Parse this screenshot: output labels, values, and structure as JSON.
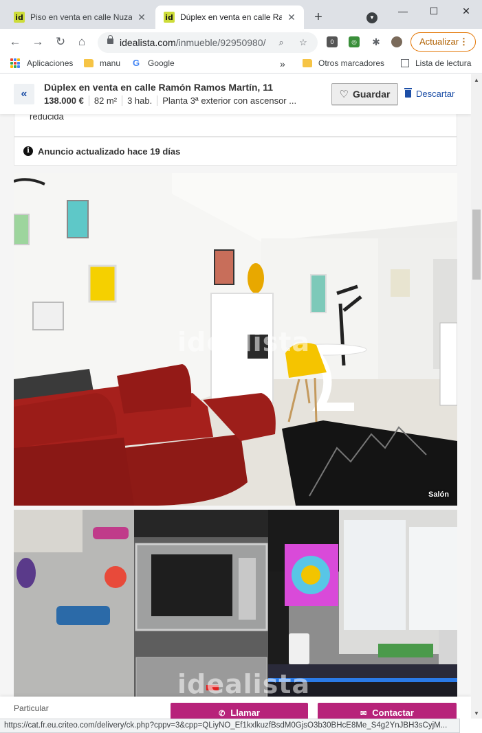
{
  "browser": {
    "tabs": [
      {
        "title": "Piso en venta en calle Nuzas",
        "favicon": "id",
        "active": false
      },
      {
        "title": "Dúplex en venta en calle Ram",
        "favicon": "id",
        "active": true
      }
    ],
    "new_tab_icon": "+",
    "url_domain": "idealista.com",
    "url_path": "/inmueble/92950980/",
    "update_button": "Actualizar",
    "bookmarks": {
      "apps": "Aplicaciones",
      "manu": "manu",
      "google": "Google",
      "more": "»",
      "other": "Otros marcadores",
      "reading_list": "Lista de lectura"
    }
  },
  "listing": {
    "title": "Dúplex en venta en calle Ramón Ramos Martín, 11",
    "price": "138.000 €",
    "size": "82 m²",
    "rooms": "3 hab.",
    "floor": "Planta 3ª exterior con ascensor ...",
    "save_label": "Guardar",
    "discard_label": "Descartar",
    "reduced_fragment": "reducida",
    "updated_notice": "Anuncio actualizado hace 19 días"
  },
  "photos": [
    {
      "caption": "Salón",
      "watermark": "idealista"
    },
    {
      "caption": "",
      "watermark": "idealista"
    }
  ],
  "contact": {
    "advertiser_type": "Particular",
    "call_label": "Llamar",
    "contact_label": "Contactar"
  },
  "status_bar": "https://cat.fr.eu.criteo.com/delivery/ck.php?cppv=3&cpp=QLiyNO_Ef1kxlkuzfBsdM0GjsO3b30BHcE8Me_S4g2YnJBH3sCyjM...",
  "colors": {
    "brand_magenta": "#b7237a",
    "link_blue": "#1c4ea6",
    "favicon_green": "#cddc39"
  }
}
